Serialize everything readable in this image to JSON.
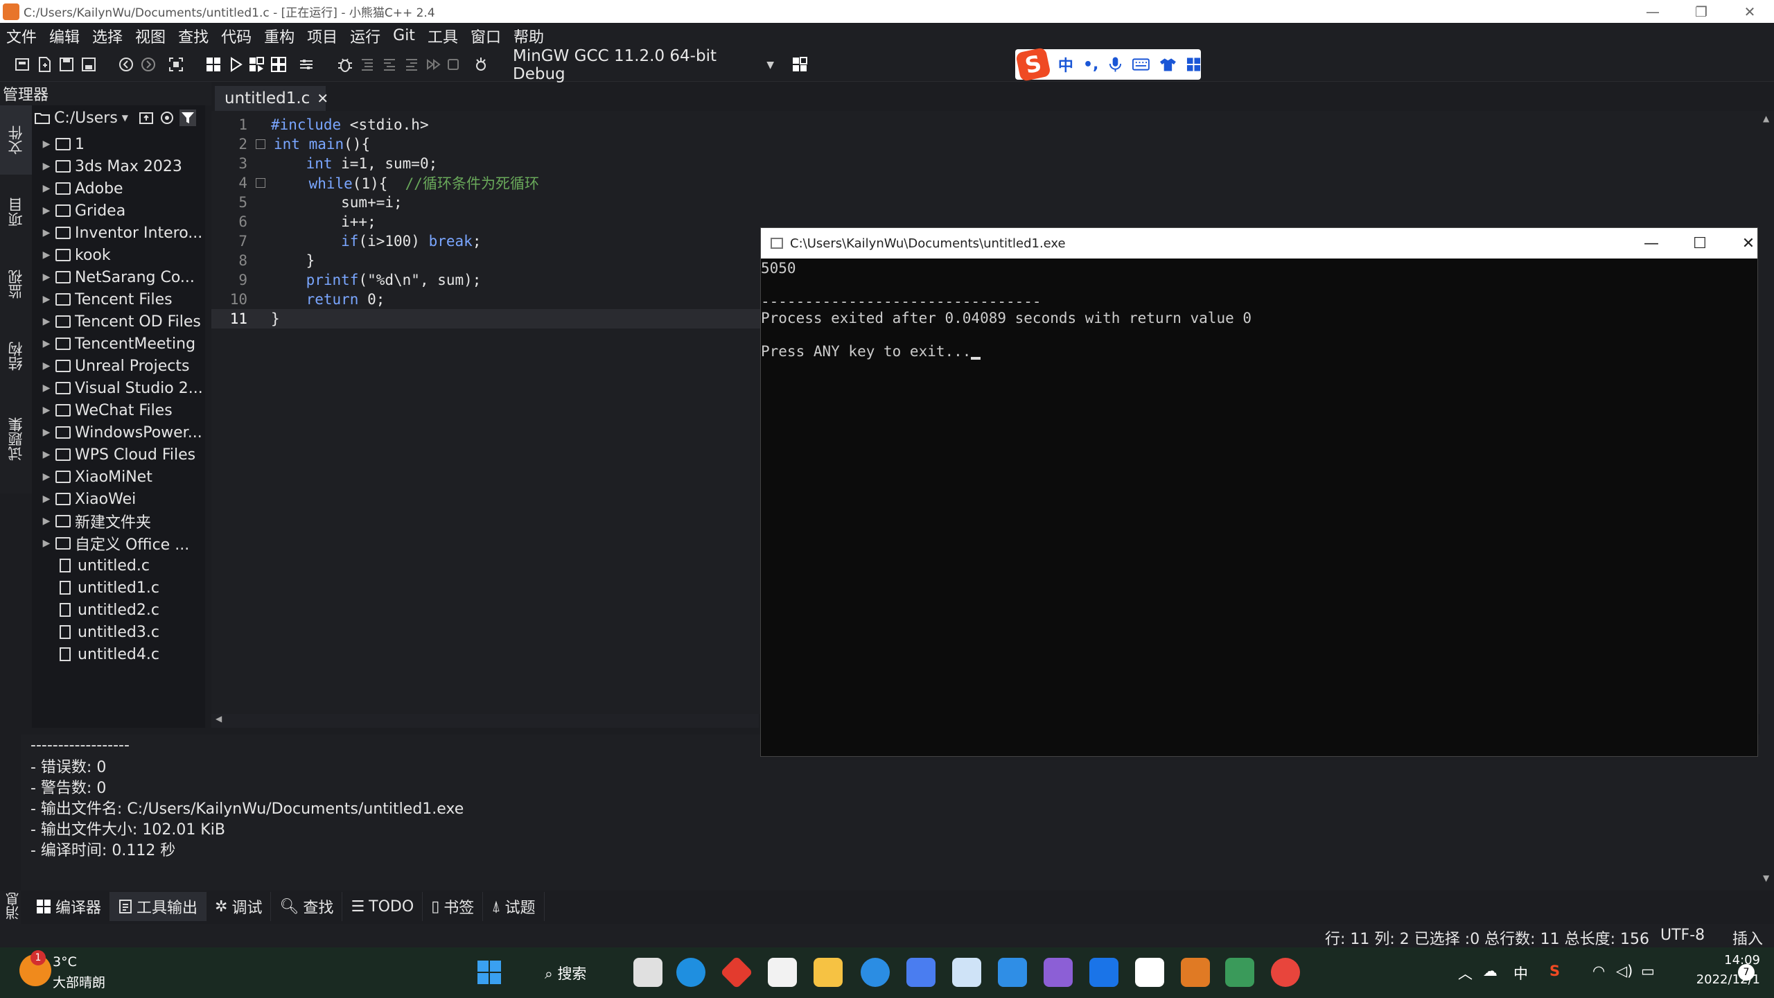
{
  "window": {
    "title": "C:/Users/KailynWu/Documents/untitled1.c - [正在运行] - 小熊猫C++ 2.4",
    "minimize": "—",
    "maximize": "❐",
    "close": "✕"
  },
  "menu": [
    "文件",
    "编辑",
    "选择",
    "视图",
    "查找",
    "代码",
    "重构",
    "项目",
    "运行",
    "Git",
    "工具",
    "窗口",
    "帮助"
  ],
  "toolbar": {
    "compiler": "MinGW GCC 11.2.0 64-bit Debug"
  },
  "ime": {
    "lang": "中",
    "punct": "•,"
  },
  "sidebar": {
    "header": "管理器",
    "vtabs": [
      "文件",
      "项目",
      "监视",
      "结构",
      "试题集"
    ],
    "path": "C:/Users",
    "files": [
      {
        "name": "1",
        "type": "folder"
      },
      {
        "name": "3ds Max 2023",
        "type": "folder"
      },
      {
        "name": "Adobe",
        "type": "folder"
      },
      {
        "name": "Gridea",
        "type": "folder"
      },
      {
        "name": "Inventor Intero...",
        "type": "folder"
      },
      {
        "name": "kook",
        "type": "folder"
      },
      {
        "name": "NetSarang Co...",
        "type": "folder"
      },
      {
        "name": "Tencent Files",
        "type": "folder"
      },
      {
        "name": "Tencent OD Files",
        "type": "folder"
      },
      {
        "name": "TencentMeeting",
        "type": "folder"
      },
      {
        "name": "Unreal Projects",
        "type": "folder"
      },
      {
        "name": "Visual Studio 2...",
        "type": "folder"
      },
      {
        "name": "WeChat Files",
        "type": "folder"
      },
      {
        "name": "WindowsPower...",
        "type": "folder"
      },
      {
        "name": "WPS Cloud Files",
        "type": "folder"
      },
      {
        "name": "XiaoMiNet",
        "type": "folder"
      },
      {
        "name": "XiaoWei",
        "type": "folder"
      },
      {
        "name": "新建文件夹",
        "type": "folder"
      },
      {
        "name": "自定义 Office ...",
        "type": "folder"
      },
      {
        "name": "untitled.c",
        "type": "file"
      },
      {
        "name": "untitled1.c",
        "type": "file"
      },
      {
        "name": "untitled2.c",
        "type": "file"
      },
      {
        "name": "untitled3.c",
        "type": "file"
      },
      {
        "name": "untitled4.c",
        "type": "file"
      }
    ]
  },
  "editor": {
    "tab": "untitled1.c",
    "lines": [
      {
        "n": "1",
        "code": "#include <stdio.h>"
      },
      {
        "n": "2",
        "code": "int main(){"
      },
      {
        "n": "3",
        "code": "    int i=1, sum=0;"
      },
      {
        "n": "4",
        "code": "    while(1){  //循环条件为死循环"
      },
      {
        "n": "5",
        "code": "        sum+=i;"
      },
      {
        "n": "6",
        "code": "        i++;"
      },
      {
        "n": "7",
        "code": "        if(i>100) break;"
      },
      {
        "n": "8",
        "code": "    }"
      },
      {
        "n": "9",
        "code": "    printf(\"%d\\n\", sum);"
      },
      {
        "n": "10",
        "code": "    return 0;"
      },
      {
        "n": "11",
        "code": "}"
      }
    ]
  },
  "console": {
    "title": "C:\\Users\\KailynWu\\Documents\\untitled1.exe",
    "lines": [
      "5050",
      "",
      "--------------------------------",
      "Process exited after 0.04089 seconds with return value 0",
      "",
      "Press ANY key to exit..."
    ]
  },
  "output": {
    "lines": [
      "------------------",
      "- 错误数: 0",
      "- 警告数: 0",
      "- 输出文件名: C:/Users/KailynWu/Documents/untitled1.exe",
      "- 输出文件大小: 102.01 KiB",
      "- 编译时间: 0.112 秒"
    ]
  },
  "bottom_tabs": [
    "编译器",
    "工具输出",
    "调试",
    "查找",
    "TODO",
    "书签",
    "试题"
  ],
  "msg_tab": "消息",
  "status": {
    "position": "行: 11 列: 2 已选择 :0 总行数: 11 总长度: 156",
    "encoding": "UTF-8",
    "mode": "插入"
  },
  "taskbar": {
    "weather_temp": "3°C",
    "weather_desc": "大部晴朗",
    "weather_badge": "1",
    "search": "搜索",
    "ime": "中",
    "time": "14:09",
    "date": "2022/12/1",
    "notif": "7"
  }
}
